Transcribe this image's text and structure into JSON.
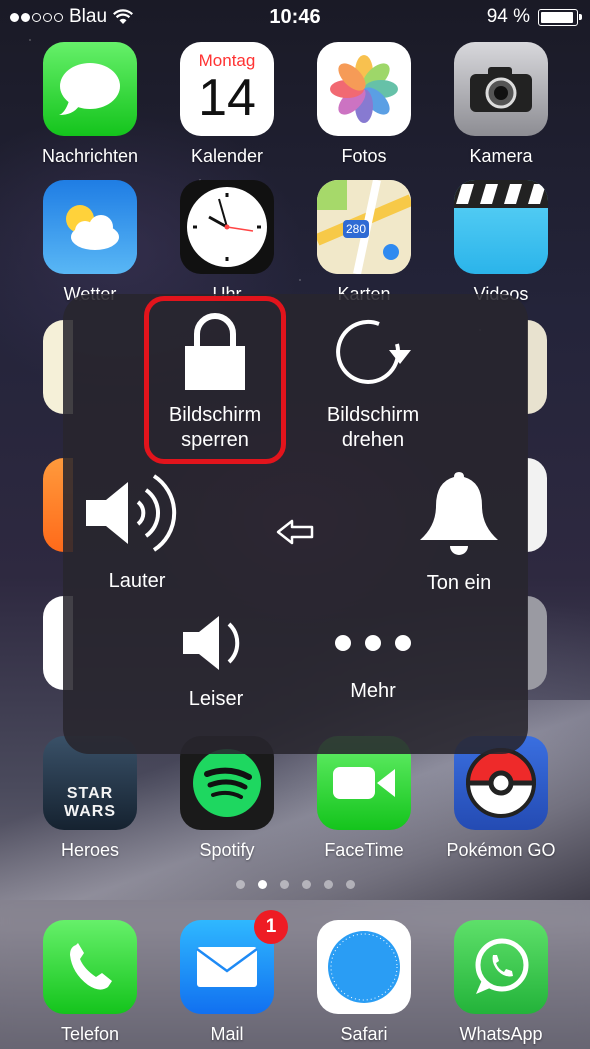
{
  "status_bar": {
    "carrier": "Blau",
    "time": "10:46",
    "battery_percent": "94 %",
    "battery_level": 0.94,
    "signal_bars_filled": 2,
    "signal_bars_total": 5
  },
  "home_screen": {
    "row1": [
      {
        "name": "Nachrichten"
      },
      {
        "name": "Kalender",
        "weekday": "Montag",
        "day": "14"
      },
      {
        "name": "Fotos"
      },
      {
        "name": "Kamera"
      }
    ],
    "row2": [
      {
        "name": "Wetter"
      },
      {
        "name": "Uhr"
      },
      {
        "name": "Karten",
        "road_shield": "280"
      },
      {
        "name": "Videos"
      }
    ],
    "row6": [
      {
        "name": "Heroes",
        "icon_text": "STAR WARS"
      },
      {
        "name": "Spotify"
      },
      {
        "name": "FaceTime"
      },
      {
        "name": "Pokémon GO"
      }
    ],
    "page_count": 6,
    "active_page": 2
  },
  "dock": [
    {
      "name": "Telefon"
    },
    {
      "name": "Mail",
      "badge": "1"
    },
    {
      "name": "Safari"
    },
    {
      "name": "WhatsApp"
    }
  ],
  "assistive_touch": {
    "lock_screen": {
      "line1": "Bildschirm",
      "line2": "sperren"
    },
    "rotate_screen": {
      "line1": "Bildschirm",
      "line2": "drehen"
    },
    "volume_up": "Lauter",
    "sound_on": "Ton ein",
    "volume_down": "Leiser",
    "more": "Mehr"
  },
  "colors": {
    "highlight": "#e2141c",
    "badge": "#ee1c24"
  }
}
